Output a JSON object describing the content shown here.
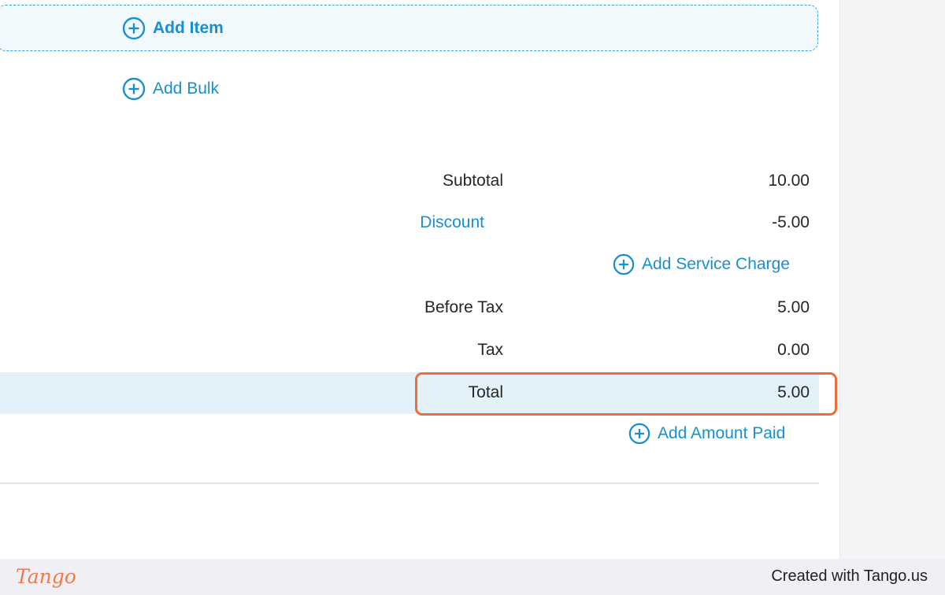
{
  "actions": {
    "add_item": "Add Item",
    "add_bulk": "Add Bulk",
    "add_service_charge": "Add Service Charge",
    "add_amount_paid": "Add Amount Paid"
  },
  "summary": {
    "subtotal": {
      "label": "Subtotal",
      "value": "10.00"
    },
    "discount": {
      "label": "Discount",
      "value": "-5.00"
    },
    "before_tax": {
      "label": "Before Tax",
      "value": "5.00"
    },
    "tax": {
      "label": "Tax",
      "value": "0.00"
    },
    "total": {
      "label": "Total",
      "value": "5.00"
    }
  },
  "footer": {
    "brand": "Tango",
    "credit": "Created with Tango.us"
  },
  "icons": {
    "add": "plus-circle-icon"
  },
  "colors": {
    "link": "#1a8fd0",
    "highlight": "#f06c3c",
    "total_row_bg": "#e2f1fa",
    "brand": "#f07a4a"
  }
}
